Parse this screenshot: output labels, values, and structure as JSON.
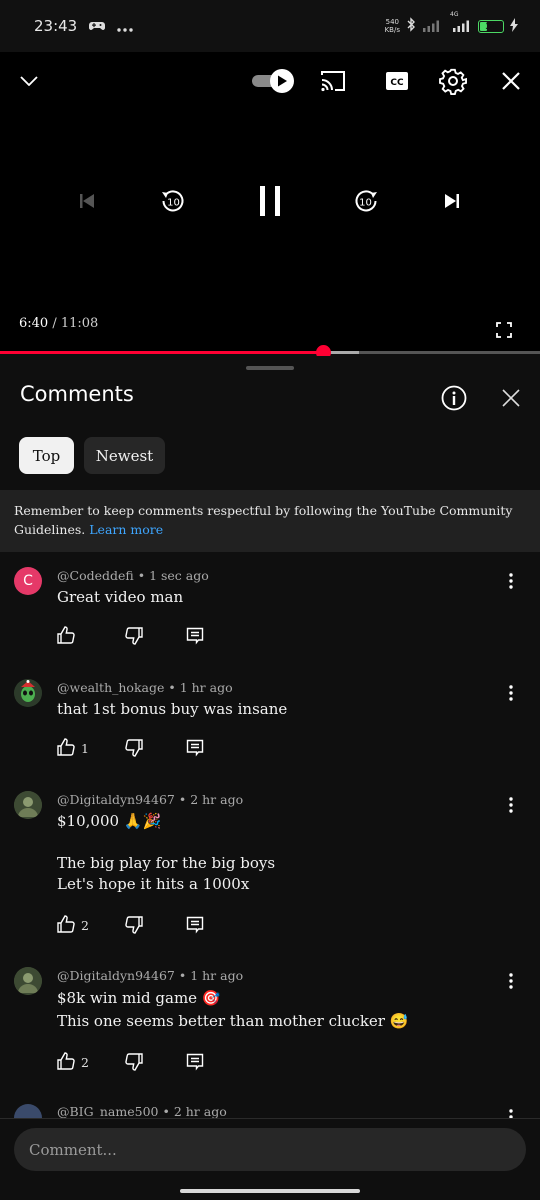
{
  "status_bar": {
    "time": "23:43",
    "net_speed_value": "540",
    "net_speed_unit": "KB/s",
    "network": "4G",
    "battery_level": "34",
    "battery_fraction": 0.34
  },
  "player": {
    "current_time": "6:40",
    "separator": " / ",
    "duration": "11:08",
    "played_fraction": 0.598,
    "buffered_fraction": 0.664,
    "icons": [
      "chevron-down-icon",
      "autoplay-toggle-icon",
      "cast-icon",
      "captions-icon",
      "settings-gear-icon",
      "close-icon",
      "previous-icon",
      "rewind-10-icon",
      "pause-icon",
      "forward-10-icon",
      "next-icon",
      "fullscreen-icon"
    ],
    "captions_label": "CC",
    "rewind_label": "10",
    "forward_label": "10"
  },
  "comments_panel": {
    "title": "Comments",
    "sort_chips": [
      "Top",
      "Newest"
    ],
    "selected_chip": "Top",
    "notice_text": "Remember to keep comments respectful by following the YouTube Community Guidelines.",
    "notice_link": "Learn more",
    "comments": [
      {
        "avatar_letter": "C",
        "avatar_color": "#e53968",
        "author": "@Codeddefi",
        "time": "1 sec ago",
        "text": "Great video man",
        "likes": ""
      },
      {
        "avatar_letter": "",
        "avatar_color": "#2c3a2a",
        "author": "@wealth_hokage",
        "time": "1 hr ago",
        "text": "that 1st bonus buy was insane",
        "likes": "1"
      },
      {
        "avatar_letter": "",
        "avatar_color": "#46533a",
        "author": "@Digitaldyn94467",
        "time": "2 hr ago",
        "text": "$10,000 🙏🎉\n\nThe big play for the big boys\nLet's hope it hits a 1000x",
        "likes": "2"
      },
      {
        "avatar_letter": "",
        "avatar_color": "#46533a",
        "author": "@Digitaldyn94467",
        "time": "1 hr ago",
        "text": "$8k win mid game 🎯\nThis one seems better than mother clucker 😅",
        "likes": "2"
      },
      {
        "avatar_letter": "",
        "avatar_color": "#3a4a6a",
        "author": "@BIG_name500",
        "time": "2 hr ago",
        "text": "",
        "likes": ""
      }
    ],
    "meta_separator": " • "
  },
  "comment_input": {
    "placeholder": "Comment..."
  },
  "colors": {
    "accent_red": "#ff0033",
    "link_blue": "#3ea6ff",
    "battery_green": "#4cd964"
  }
}
